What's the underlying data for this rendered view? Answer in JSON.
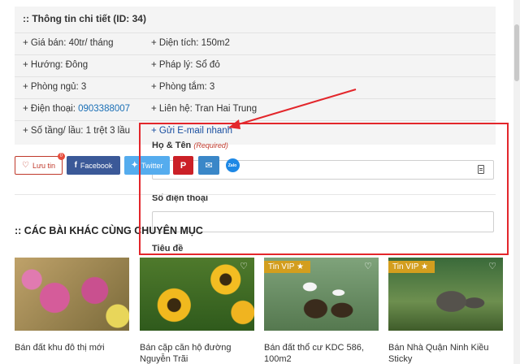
{
  "detail": {
    "title": ":: Thông tin chi tiết (ID: 34)",
    "rows": [
      {
        "c1": "+ Giá bán: 40tr/ tháng",
        "c2": "+ Diện tích: 150m2"
      },
      {
        "c1": "+ Hướng: Đông",
        "c2": "+ Pháp lý: Sổ đỏ"
      },
      {
        "c1": "+ Phòng ngủ: 3",
        "c2": "+ Phòng tắm: 3"
      },
      {
        "c1_prefix": "+ Điện thoại: ",
        "c1_phone": "0903388007",
        "c2": "+ Liên hệ: Tran Hai Trung"
      },
      {
        "c1": "+ Số tầng/ lầu: 1 trệt 3 lầu",
        "c2": "+ Gửi E-mail nhanh"
      }
    ]
  },
  "form": {
    "name_label": "Họ & Tên",
    "name_required": "(Required)",
    "name_value": "",
    "phone_label": "Số điện thoại",
    "phone_value": "",
    "subject_label": "Tiêu đề"
  },
  "share": {
    "save_label": "Lưu tin",
    "save_count": "0",
    "facebook_label": "Facebook",
    "twitter_label": "Twitter",
    "zalo_label": "Zalo"
  },
  "section": {
    "title": ":: CÁC BÀI KHÁC CÙNG CHUYÊN MỤC"
  },
  "cards": [
    {
      "title": "Bán đất khu đô thị mới",
      "vip": ""
    },
    {
      "title": "Bán cặp căn hộ đường Nguyễn Trãi",
      "vip": ""
    },
    {
      "title": "Bán đất thổ cư KDC 586, 100m2",
      "vip": "Tin VIP ★"
    },
    {
      "title": "Bán Nhà Quận Ninh Kiều Sticky",
      "vip": "Tin VIP ★"
    }
  ],
  "colors": {
    "annotation": "#e3262b",
    "vip_badge": "#d39e1e",
    "facebook": "#3b5998",
    "twitter": "#55acee",
    "pinterest": "#cb2027"
  }
}
